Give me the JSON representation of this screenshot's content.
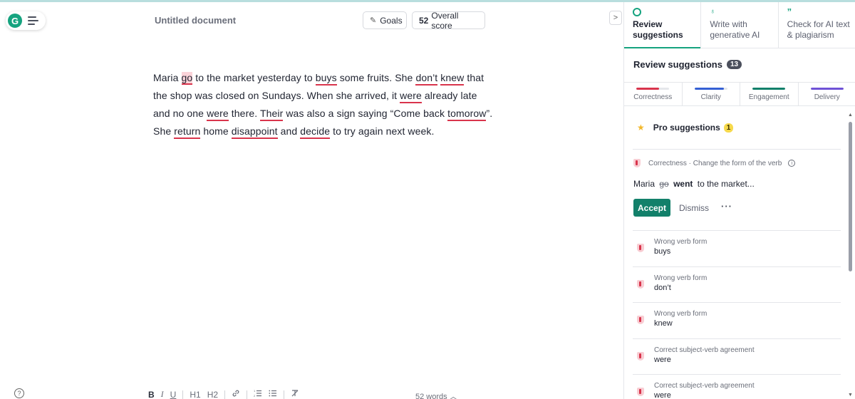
{
  "header": {
    "doc_title": "Untitled document",
    "goals_label": "Goals",
    "score_value": "52",
    "score_label": "Overall score",
    "collapse_glyph": ">"
  },
  "editor": {
    "segments": [
      {
        "text": "Maria ",
        "style": "plain"
      },
      {
        "text": "go",
        "style": "active"
      },
      {
        "text": " to the market yesterday to ",
        "style": "plain"
      },
      {
        "text": "buys",
        "style": "error"
      },
      {
        "text": " some fruits. She ",
        "style": "plain"
      },
      {
        "text": "don’t",
        "style": "error"
      },
      {
        "text": " ",
        "style": "plain"
      },
      {
        "text": "knew",
        "style": "error"
      },
      {
        "text": " that the shop was closed on Sundays. When she arrived, it ",
        "style": "plain"
      },
      {
        "text": "were",
        "style": "error"
      },
      {
        "text": " already late and no one ",
        "style": "plain"
      },
      {
        "text": "were",
        "style": "error"
      },
      {
        "text": " there. ",
        "style": "plain"
      },
      {
        "text": "Their",
        "style": "error"
      },
      {
        "text": " was also a sign saying “Come back ",
        "style": "plain"
      },
      {
        "text": "tomorow",
        "style": "error"
      },
      {
        "text": "”. She ",
        "style": "plain"
      },
      {
        "text": "return",
        "style": "error"
      },
      {
        "text": " home ",
        "style": "plain"
      },
      {
        "text": "disappoint",
        "style": "error"
      },
      {
        "text": " and ",
        "style": "plain"
      },
      {
        "text": "decide",
        "style": "error"
      },
      {
        "text": " to try again next week.",
        "style": "plain"
      }
    ]
  },
  "toolbar": {
    "bold": "B",
    "italic": "I",
    "underline": "U",
    "h1": "H1",
    "h2": "H2",
    "link": "🔗",
    "ordered_list": "⁝≡",
    "bullet_list": "⁝≡",
    "clear_format": "T̸",
    "word_count": "52 words",
    "help": "?"
  },
  "panel": {
    "tabs": [
      {
        "label": "Review suggestions",
        "icon": "grammarly-icon",
        "active": true
      },
      {
        "label": "Write with generative AI",
        "icon": "bulb-icon",
        "active": false
      },
      {
        "label": "Check for AI text & plagiarism",
        "icon": "quote-icon",
        "active": false
      }
    ],
    "review_title": "Review suggestions",
    "review_count": "13",
    "categories": [
      {
        "label": "Correctness",
        "color": "#d9344c",
        "fill": 0.7
      },
      {
        "label": "Clarity",
        "color": "#3560d4",
        "fill": 0.9
      },
      {
        "label": "Engagement",
        "color": "#12806a",
        "fill": 1.0
      },
      {
        "label": "Delivery",
        "color": "#6f52d6",
        "fill": 1.0
      }
    ],
    "pro_label": "Pro suggestions",
    "pro_count": "1",
    "active_card": {
      "category": "Correctness · Change the form of the verb",
      "preview_before": "Maria",
      "preview_removed": "go",
      "preview_added": "went",
      "preview_after": "to the market...",
      "accept_label": "Accept",
      "dismiss_label": "Dismiss",
      "more_label": "···"
    },
    "suggestions": [
      {
        "type": "Wrong verb form",
        "word": "buys"
      },
      {
        "type": "Wrong verb form",
        "word": "don’t"
      },
      {
        "type": "Wrong verb form",
        "word": "knew"
      },
      {
        "type": "Correct subject-verb agreement",
        "word": "were"
      },
      {
        "type": "Correct subject-verb agreement",
        "word": "were"
      }
    ]
  }
}
